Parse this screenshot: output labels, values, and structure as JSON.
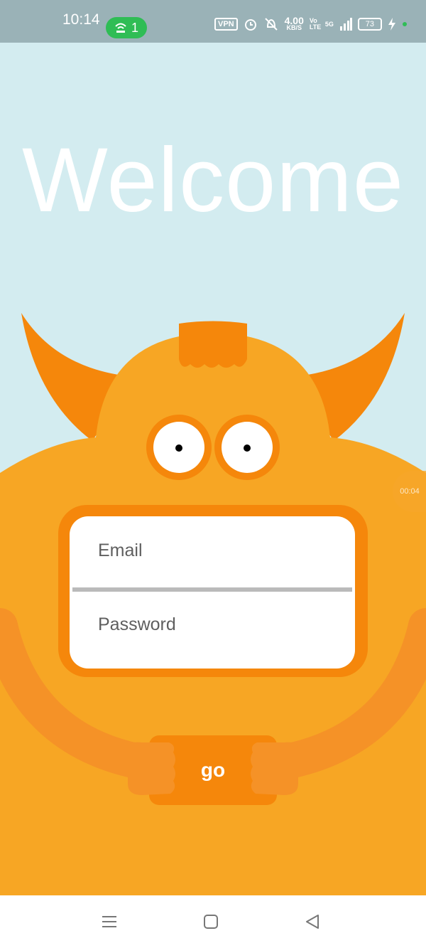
{
  "status_bar": {
    "time": "10:14",
    "hotspot_count": "1",
    "vpn": "VPN",
    "speed_value": "4.00",
    "speed_unit": "KB/S",
    "volte": "Vo LTE",
    "network": "5G",
    "battery": "73",
    "icons": [
      "wifi-hotspot-icon",
      "alarm-icon",
      "mute-icon",
      "signal-icon",
      "battery-icon",
      "charging-icon"
    ]
  },
  "welcome": {
    "title": "Welcome"
  },
  "form": {
    "email_placeholder": "Email",
    "password_placeholder": "Password",
    "submit_label": "go"
  },
  "overlay": {
    "timer": "00:04"
  },
  "nav_bar": {
    "icons": [
      "menu-icon",
      "home-icon",
      "back-icon"
    ]
  },
  "colors": {
    "sky": "#d3ecf0",
    "monster_body": "#f7a624",
    "monster_dark": "#f5870b",
    "arm": "#f59227"
  }
}
